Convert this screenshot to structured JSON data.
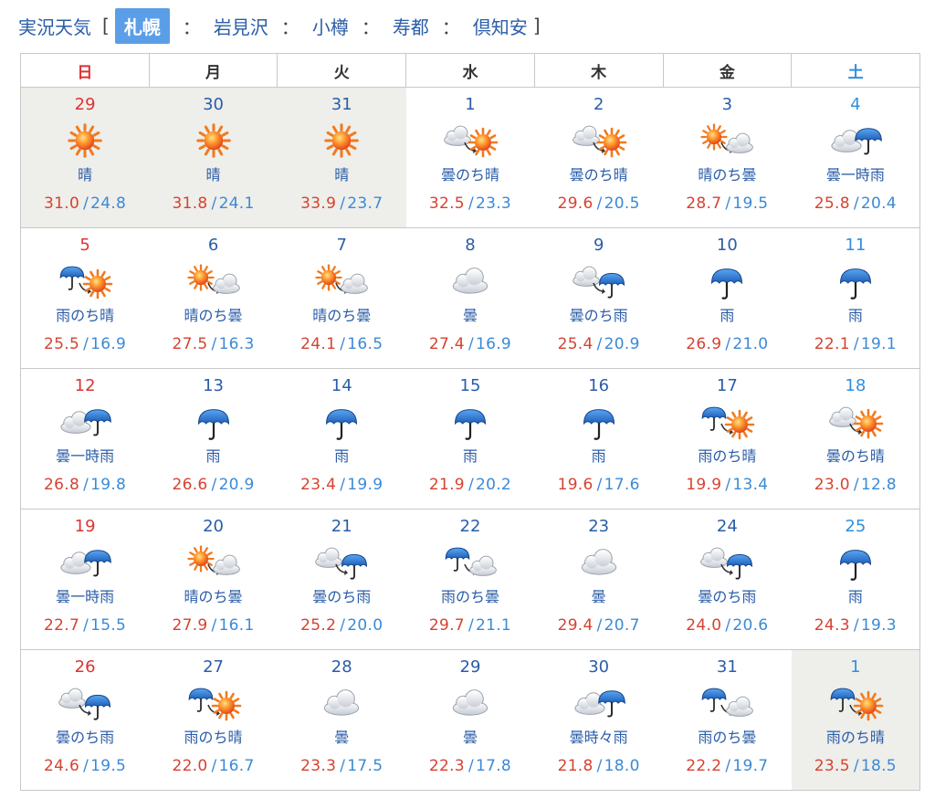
{
  "nav": {
    "prefix": "実況天気",
    "open_bracket": "[",
    "close_bracket": "]",
    "separator": "：",
    "locations": [
      {
        "label": "札幌",
        "active": true
      },
      {
        "label": "岩見沢",
        "active": false
      },
      {
        "label": "小樽",
        "active": false
      },
      {
        "label": "寿都",
        "active": false
      },
      {
        "label": "倶知安",
        "active": false
      }
    ]
  },
  "calendar": {
    "weekdays": [
      "日",
      "月",
      "火",
      "水",
      "木",
      "金",
      "土"
    ],
    "temp_separator": "/",
    "colors": {
      "high": "#d64230",
      "low": "#3a8ad6",
      "sunday": "#d33333",
      "saturday": "#2f8fe0",
      "past_bg": "#eeeeea"
    },
    "weeks": [
      [
        {
          "date": "29",
          "weather": "晴",
          "icon": "sun-icon",
          "high": "31.0",
          "low": "24.8",
          "past": true
        },
        {
          "date": "30",
          "weather": "晴",
          "icon": "sun-icon",
          "high": "31.8",
          "low": "24.1",
          "past": true
        },
        {
          "date": "31",
          "weather": "晴",
          "icon": "sun-icon",
          "high": "33.9",
          "low": "23.7",
          "past": true
        },
        {
          "date": "1",
          "weather": "曇のち晴",
          "icon": "cloud-then-sun-icon",
          "high": "32.5",
          "low": "23.3"
        },
        {
          "date": "2",
          "weather": "曇のち晴",
          "icon": "cloud-then-sun-icon",
          "high": "29.6",
          "low": "20.5"
        },
        {
          "date": "3",
          "weather": "晴のち曇",
          "icon": "sun-then-cloud-icon",
          "high": "28.7",
          "low": "19.5"
        },
        {
          "date": "4",
          "weather": "曇一時雨",
          "icon": "cloud-sometimes-rain-icon",
          "high": "25.8",
          "low": "20.4"
        }
      ],
      [
        {
          "date": "5",
          "weather": "雨のち晴",
          "icon": "rain-then-sun-icon",
          "high": "25.5",
          "low": "16.9"
        },
        {
          "date": "6",
          "weather": "晴のち曇",
          "icon": "sun-then-cloud-icon",
          "high": "27.5",
          "low": "16.3"
        },
        {
          "date": "7",
          "weather": "晴のち曇",
          "icon": "sun-then-cloud-icon",
          "high": "24.1",
          "low": "16.5"
        },
        {
          "date": "8",
          "weather": "曇",
          "icon": "cloud-icon",
          "high": "27.4",
          "low": "16.9"
        },
        {
          "date": "9",
          "weather": "曇のち雨",
          "icon": "cloud-then-rain-icon",
          "high": "25.4",
          "low": "20.9"
        },
        {
          "date": "10",
          "weather": "雨",
          "icon": "umbrella-icon",
          "high": "26.9",
          "low": "21.0"
        },
        {
          "date": "11",
          "weather": "雨",
          "icon": "umbrella-icon",
          "high": "22.1",
          "low": "19.1"
        }
      ],
      [
        {
          "date": "12",
          "weather": "曇一時雨",
          "icon": "cloud-sometimes-rain-icon",
          "high": "26.8",
          "low": "19.8"
        },
        {
          "date": "13",
          "weather": "雨",
          "icon": "umbrella-icon",
          "high": "26.6",
          "low": "20.9"
        },
        {
          "date": "14",
          "weather": "雨",
          "icon": "umbrella-icon",
          "high": "23.4",
          "low": "19.9"
        },
        {
          "date": "15",
          "weather": "雨",
          "icon": "umbrella-icon",
          "high": "21.9",
          "low": "20.2"
        },
        {
          "date": "16",
          "weather": "雨",
          "icon": "umbrella-icon",
          "high": "19.6",
          "low": "17.6"
        },
        {
          "date": "17",
          "weather": "雨のち晴",
          "icon": "rain-then-sun-icon",
          "high": "19.9",
          "low": "13.4"
        },
        {
          "date": "18",
          "weather": "曇のち晴",
          "icon": "cloud-then-sun-icon",
          "high": "23.0",
          "low": "12.8"
        }
      ],
      [
        {
          "date": "19",
          "weather": "曇一時雨",
          "icon": "cloud-sometimes-rain-icon",
          "high": "22.7",
          "low": "15.5"
        },
        {
          "date": "20",
          "weather": "晴のち曇",
          "icon": "sun-then-cloud-icon",
          "high": "27.9",
          "low": "16.1"
        },
        {
          "date": "21",
          "weather": "曇のち雨",
          "icon": "cloud-then-rain-icon",
          "high": "25.2",
          "low": "20.0"
        },
        {
          "date": "22",
          "weather": "雨のち曇",
          "icon": "rain-then-cloud-icon",
          "high": "29.7",
          "low": "21.1"
        },
        {
          "date": "23",
          "weather": "曇",
          "icon": "cloud-icon",
          "high": "29.4",
          "low": "20.7"
        },
        {
          "date": "24",
          "weather": "曇のち雨",
          "icon": "cloud-then-rain-icon",
          "high": "24.0",
          "low": "20.6"
        },
        {
          "date": "25",
          "weather": "雨",
          "icon": "umbrella-icon",
          "high": "24.3",
          "low": "19.3"
        }
      ],
      [
        {
          "date": "26",
          "weather": "曇のち雨",
          "icon": "cloud-then-rain-icon",
          "high": "24.6",
          "low": "19.5"
        },
        {
          "date": "27",
          "weather": "雨のち晴",
          "icon": "rain-then-sun-icon",
          "high": "22.0",
          "low": "16.7"
        },
        {
          "date": "28",
          "weather": "曇",
          "icon": "cloud-icon",
          "high": "23.3",
          "low": "17.5"
        },
        {
          "date": "29",
          "weather": "曇",
          "icon": "cloud-icon",
          "high": "22.3",
          "low": "17.8"
        },
        {
          "date": "30",
          "weather": "曇時々雨",
          "icon": "cloud-sometimes-rain-icon",
          "high": "21.8",
          "low": "18.0"
        },
        {
          "date": "31",
          "weather": "雨のち曇",
          "icon": "rain-then-cloud-icon",
          "high": "22.2",
          "low": "19.7"
        },
        {
          "date": "1",
          "weather": "雨のち晴",
          "icon": "rain-then-sun-icon",
          "high": "23.5",
          "low": "18.5",
          "past": true
        }
      ]
    ]
  }
}
